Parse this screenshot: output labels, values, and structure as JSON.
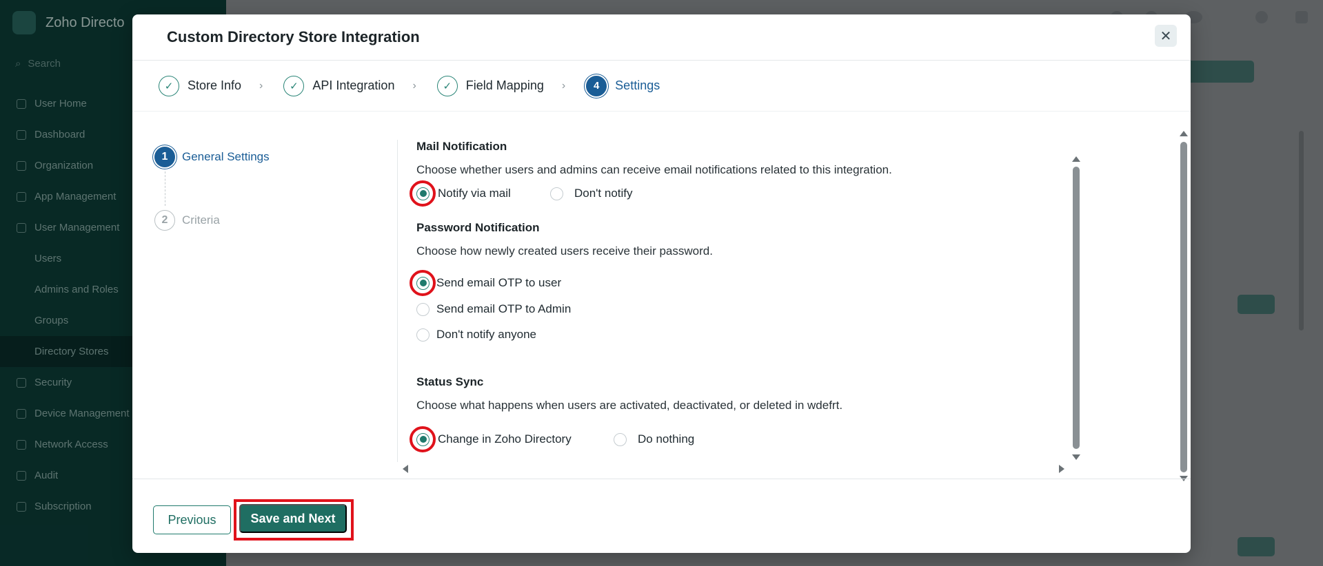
{
  "background": {
    "app_name": "Zoho Directo",
    "search_placeholder": "Search",
    "nav": [
      "User Home",
      "Dashboard",
      "Organization",
      "App Management",
      "User Management",
      "Users",
      "Admins and Roles",
      "Groups",
      "Directory Stores",
      "Security",
      "Device Management",
      "Network Access",
      "Audit",
      "Subscription"
    ]
  },
  "modal": {
    "title": "Custom Directory Store Integration",
    "close_icon": "close-icon",
    "steps": [
      {
        "label": "Store Info",
        "status": "done"
      },
      {
        "label": "API Integration",
        "status": "done"
      },
      {
        "label": "Field Mapping",
        "status": "done"
      },
      {
        "label": "Settings",
        "status": "current",
        "number": "4"
      }
    ],
    "substeps": [
      {
        "number": "1",
        "label": "General Settings",
        "status": "active"
      },
      {
        "number": "2",
        "label": "Criteria",
        "status": "inactive"
      }
    ],
    "sections": {
      "mail": {
        "title": "Mail Notification",
        "desc": "Choose whether users and admins can receive email notifications related to this integration.",
        "options": [
          "Notify via mail",
          "Don't notify"
        ],
        "selected": "Notify via mail"
      },
      "password": {
        "title": "Password Notification",
        "desc": "Choose how newly created users receive their password.",
        "options": [
          "Send email OTP to user",
          "Send email OTP to Admin",
          "Don't notify anyone"
        ],
        "selected": "Send email OTP to user"
      },
      "status": {
        "title": "Status Sync",
        "desc": "Choose what happens when users are activated, deactivated, or deleted in wdefrt.",
        "options": [
          "Change in Zoho Directory",
          "Do nothing"
        ],
        "selected": "Change in Zoho Directory"
      }
    },
    "footer": {
      "previous_label": "Previous",
      "save_label": "Save and Next"
    },
    "colors": {
      "accent_teal": "#1f6e62",
      "current_blue": "#1a5d96",
      "highlight_red": "#e0121b"
    }
  }
}
